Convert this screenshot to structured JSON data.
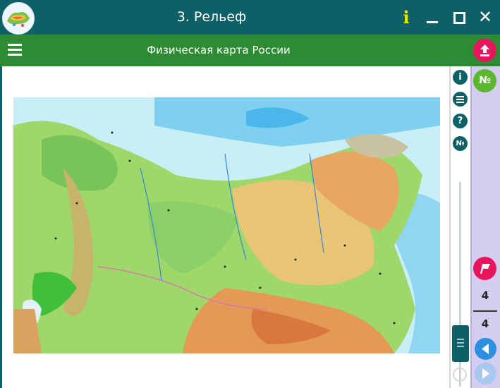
{
  "window": {
    "title": "3. Рельеф",
    "close_glyph": "✕"
  },
  "toolbar": {
    "subtitle": "Физическая карта России"
  },
  "right_toolbar": {
    "help_glyph": "?",
    "number_glyph": "№"
  },
  "panel": {
    "number_glyph": "№"
  },
  "pagination": {
    "current": "4",
    "total": "4"
  },
  "colors": {
    "titlebar": "#0d6066",
    "toolbar": "#2f8b33",
    "side_panel": "#d3cdf0",
    "accent_pink": "#e8155d",
    "accent_green": "#5bb82e",
    "accent_blue": "#2c8fe0"
  },
  "icons": [
    "app-logo-icon",
    "info-icon",
    "minimize-icon",
    "maximize-icon",
    "close-icon",
    "menu-icon",
    "upload-icon",
    "info-circle-icon",
    "list-icon",
    "help-icon",
    "number-icon",
    "refresh-icon",
    "bookmark-icon",
    "prev-arrow-icon",
    "next-arrow-icon"
  ]
}
